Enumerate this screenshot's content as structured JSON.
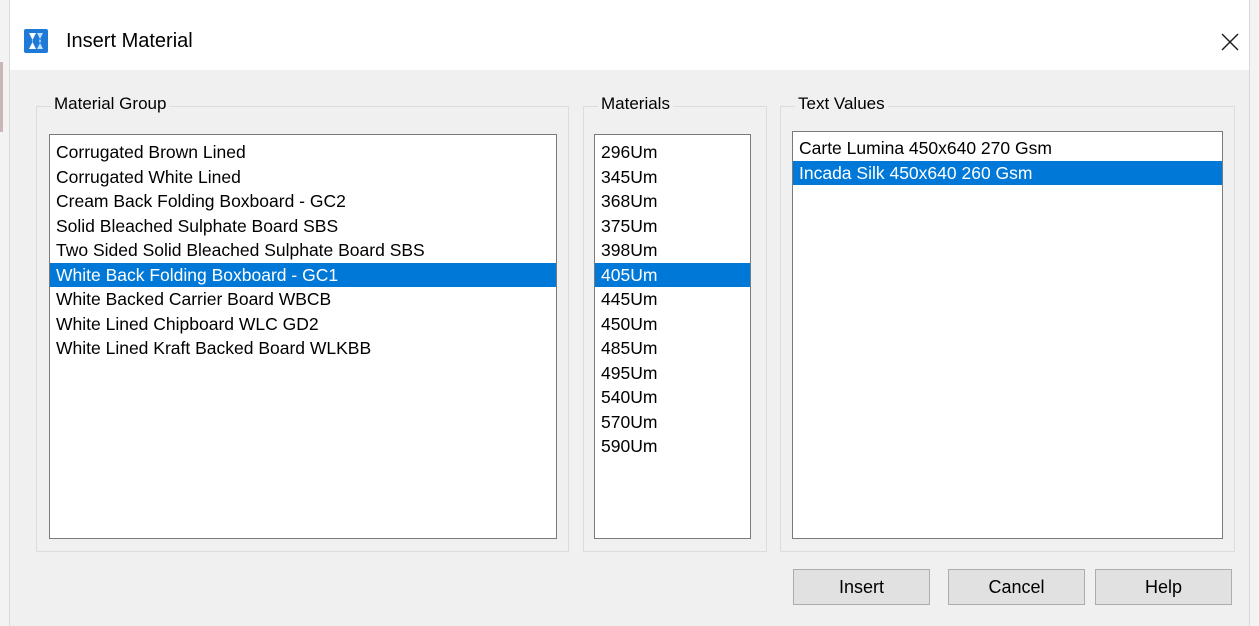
{
  "window": {
    "title": "Insert Material",
    "app_icon": "bricscad-logo-icon",
    "close_icon": "close-icon",
    "accent_color": "#0078d7"
  },
  "material_group": {
    "label": "Material Group",
    "items": [
      "Corrugated Brown Lined",
      "Corrugated White Lined",
      "Cream Back Folding Boxboard - GC2",
      "Solid Bleached Sulphate Board SBS",
      "Two Sided Solid Bleached Sulphate Board SBS",
      "White Back Folding Boxboard - GC1",
      "White Backed Carrier Board WBCB",
      "White Lined Chipboard WLC GD2",
      "White Lined Kraft Backed Board WLKBB"
    ],
    "selected": "White Back Folding Boxboard - GC1"
  },
  "materials": {
    "label": "Materials",
    "items": [
      "296Um",
      "345Um",
      "368Um",
      "375Um",
      "398Um",
      "405Um",
      "445Um",
      "450Um",
      "485Um",
      "495Um",
      "540Um",
      "570Um",
      "590Um"
    ],
    "selected": "405Um"
  },
  "text_values": {
    "label": "Text Values",
    "items": [
      "Carte Lumina 450x640 270 Gsm",
      "Incada Silk 450x640 260 Gsm"
    ],
    "selected": "Incada Silk 450x640 260 Gsm"
  },
  "buttons": {
    "insert": "Insert",
    "cancel": "Cancel",
    "help": "Help"
  }
}
